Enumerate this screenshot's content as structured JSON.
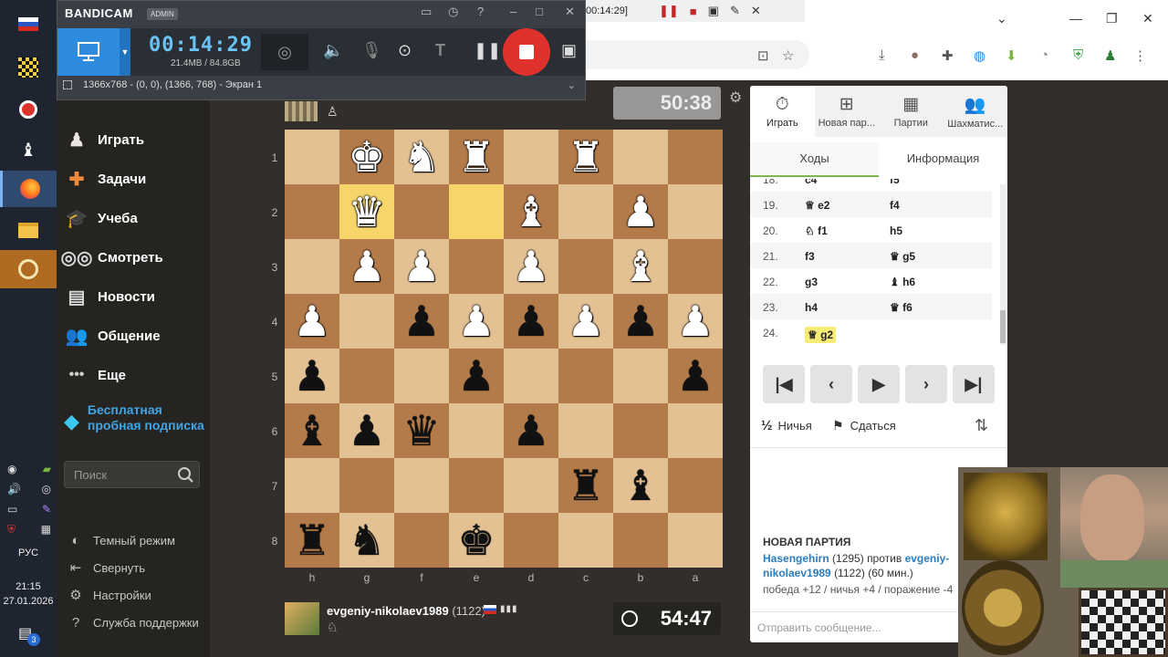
{
  "taskbar": {
    "lang": "РУС",
    "time": "21:15",
    "date": "27.01.2026",
    "notif_count": "3"
  },
  "bandicam": {
    "title": "BANDICAM",
    "badge": "ADMIN",
    "timer": "00:14:29",
    "size": "21.4MB / 84.8GB",
    "region": "1366x768 - (0, 0), (1366, 768) - Экран 1",
    "mini_time": "00:14:29]"
  },
  "sidenav": {
    "items": [
      "Играть",
      "Задачи",
      "Учеба",
      "Смотреть",
      "Новости",
      "Общение",
      "Еще"
    ],
    "trial": "Бесплатная пробная подписка",
    "search_placeholder": "Поиск",
    "bottom": [
      "Темный режим",
      "Свернуть",
      "Настройки",
      "Служба поддержки"
    ]
  },
  "opponent": {
    "clock": "50:38"
  },
  "board": {
    "ranks": [
      "1",
      "2",
      "3",
      "4",
      "5",
      "6",
      "7",
      "8"
    ],
    "files": [
      "h",
      "g",
      "f",
      "e",
      "d",
      "c",
      "b",
      "a"
    ],
    "squares": [
      [
        "",
        "wK",
        "wN",
        "wR",
        "",
        "wR",
        "",
        ""
      ],
      [
        "",
        "wQ",
        "",
        "",
        "wB",
        "",
        "wP",
        ""
      ],
      [
        "",
        "wP",
        "wP",
        "",
        "wP",
        "",
        "wB",
        ""
      ],
      [
        "wP",
        "",
        "bP",
        "wP",
        "bP",
        "wP",
        "bP",
        "wP"
      ],
      [
        "bP",
        "",
        "",
        "bP",
        "",
        "",
        "",
        "bP"
      ],
      [
        "bB",
        "bP",
        "bQ",
        "",
        "bP",
        "",
        "",
        ""
      ],
      [
        "",
        "",
        "",
        "",
        "",
        "bR",
        "bB",
        ""
      ],
      [
        "bR",
        "bN",
        "",
        "bK",
        "",
        "",
        "",
        ""
      ]
    ],
    "highlights": [
      [
        1,
        1
      ],
      [
        1,
        3
      ]
    ]
  },
  "player": {
    "name": "evgeniy-nikolaev1989",
    "rating": "(1122)",
    "clock": "54:47"
  },
  "panel": {
    "tabs": [
      "Играть",
      "Новая пар...",
      "Партии",
      "Шахматис..."
    ],
    "subtabs": [
      "Ходы",
      "Информация"
    ],
    "moves": [
      {
        "num": "18.",
        "w": "c4",
        "b": "f5"
      },
      {
        "num": "19.",
        "w": "♕ e2",
        "b": "f4"
      },
      {
        "num": "20.",
        "w": "♘ f1",
        "b": "h5"
      },
      {
        "num": "21.",
        "w": "f3",
        "b": "♛ g5"
      },
      {
        "num": "22.",
        "w": "g3",
        "b": "♝ h6"
      },
      {
        "num": "23.",
        "w": "h4",
        "b": "♛ f6"
      },
      {
        "num": "24.",
        "w": "♕ g2",
        "b": ""
      }
    ],
    "draw": "Ничья",
    "draw_mark": "½",
    "resign": "Сдаться",
    "new_game_title": "НОВАЯ ПАРТИЯ",
    "white_player": "Hasengehirn",
    "white_rating": "(1295)",
    "vs": "против",
    "black_player": "evgeniy-nikolaev1989",
    "black_rating_time": "(1122) (60 мин.)",
    "score": "победа +12 / ничья +4 / поражение -4",
    "chat_placeholder": "Отправить сообщение..."
  }
}
